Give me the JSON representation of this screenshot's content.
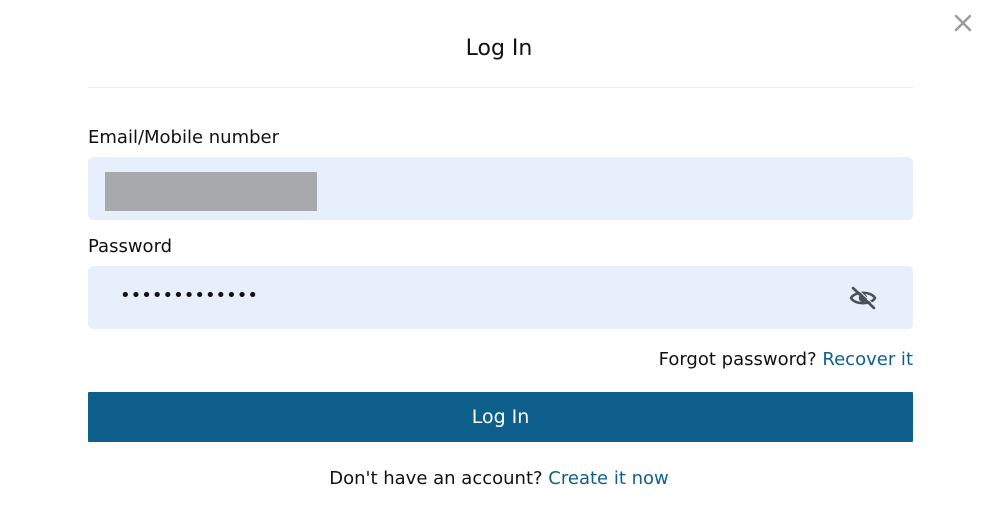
{
  "dialog": {
    "title": "Log In",
    "close_icon": "close-icon"
  },
  "email": {
    "label": "Email/Mobile number",
    "value_redacted": true
  },
  "password": {
    "label": "Password",
    "value": "•••••••••••••",
    "toggle_icon": "eye-off-icon"
  },
  "forgot": {
    "text": "Forgot password?",
    "link": "Recover it"
  },
  "login_button": {
    "label": "Log In"
  },
  "signup": {
    "text": "Don't have an account?",
    "link": "Create it now"
  },
  "colors": {
    "accent": "#0e5f8c",
    "field_bg": "#e8effc",
    "redaction": "#a7a9ad"
  }
}
